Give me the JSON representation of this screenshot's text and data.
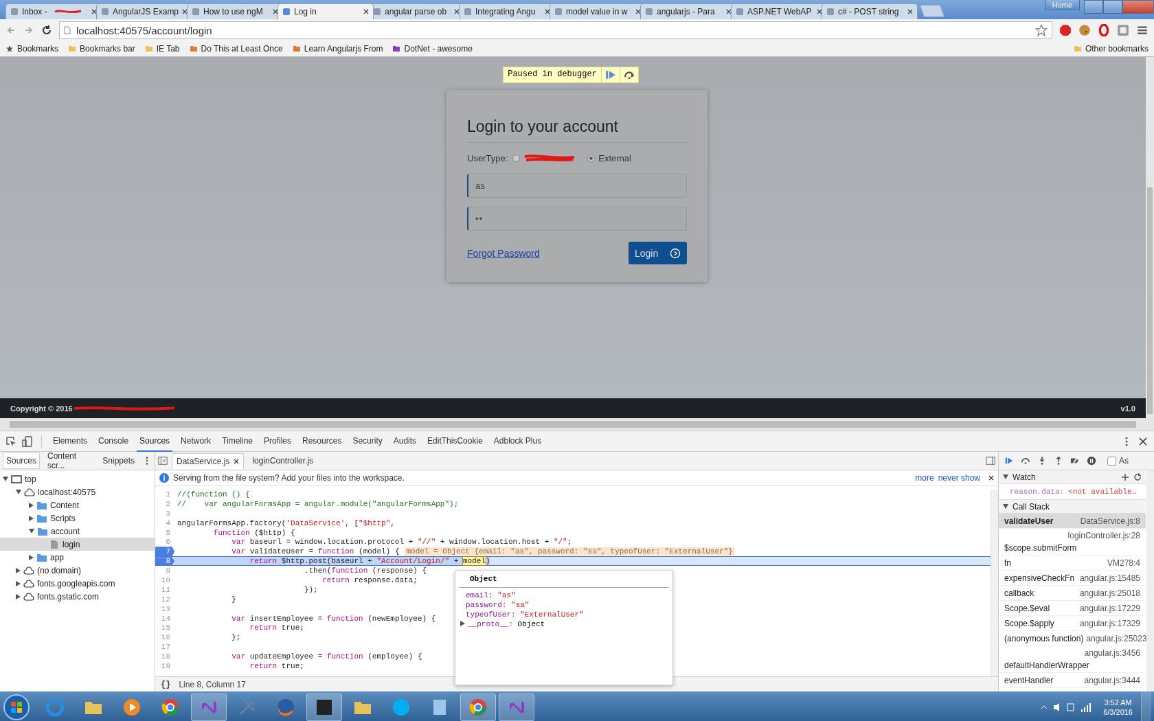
{
  "browser": {
    "tabs": [
      {
        "label": "Inbox -",
        "selected": false,
        "redacted": true
      },
      {
        "label": "AngularJS Examp",
        "selected": false
      },
      {
        "label": "How to use ngM",
        "selected": false
      },
      {
        "label": "Log in",
        "selected": true
      },
      {
        "label": "angular parse ob",
        "selected": false
      },
      {
        "label": "Integrating Angu",
        "selected": false
      },
      {
        "label": "model value in w",
        "selected": false
      },
      {
        "label": "angularjs - Para",
        "selected": false
      },
      {
        "label": "ASP.NET WebAP",
        "selected": false
      },
      {
        "label": "c# - POST string",
        "selected": false
      }
    ],
    "home_button": "Home",
    "address": "localhost:40575/account/login",
    "bookmarks": [
      "Bookmarks",
      "Bookmarks bar",
      "IE Tab",
      "Do This at Least Once",
      "Learn Angularjs From",
      "DotNet - awesome"
    ],
    "other_bookmarks": "Other bookmarks"
  },
  "page": {
    "debugger_banner": "Paused in debugger",
    "login": {
      "title": "Login to your account",
      "user_type_label": "UserType:",
      "options": [
        {
          "selected": false,
          "redacted": true
        },
        {
          "label": "External",
          "selected": true
        }
      ],
      "email": "as",
      "password": "••",
      "forgot_link": "Forgot Password",
      "login_button": "Login"
    },
    "footer": {
      "copyright": "Copyright © 2016",
      "version": "v1.0"
    }
  },
  "devtools": {
    "panels": [
      {
        "label": "Elements",
        "selected": false
      },
      {
        "label": "Console",
        "selected": false
      },
      {
        "label": "Sources",
        "selected": true
      },
      {
        "label": "Network",
        "selected": false
      },
      {
        "label": "Timeline",
        "selected": false
      },
      {
        "label": "Profiles",
        "selected": false
      },
      {
        "label": "Resources",
        "selected": false
      },
      {
        "label": "Security",
        "selected": false
      },
      {
        "label": "Audits",
        "selected": false
      },
      {
        "label": "EditThisCookie",
        "selected": false
      },
      {
        "label": "Adblock Plus",
        "selected": false
      }
    ],
    "navigator_tabs": [
      {
        "label": "Sources",
        "selected": true
      },
      {
        "label": "Content scr...",
        "selected": false
      },
      {
        "label": "Snippets",
        "selected": false
      }
    ],
    "tree": [
      {
        "label": "top",
        "kind": "frame",
        "expanded": true,
        "selected": false,
        "children": [
          {
            "label": "localhost:40575",
            "kind": "domain",
            "expanded": true,
            "selected": false,
            "children": [
              {
                "label": "Content",
                "kind": "folder",
                "expanded": false,
                "selected": false
              },
              {
                "label": "Scripts",
                "kind": "folder",
                "expanded": false,
                "selected": false
              },
              {
                "label": "account",
                "kind": "folder",
                "expanded": true,
                "selected": false,
                "children": [
                  {
                    "label": "login",
                    "kind": "file",
                    "selected": true
                  }
                ]
              },
              {
                "label": "app",
                "kind": "folder",
                "expanded": false,
                "selected": false
              }
            ]
          },
          {
            "label": "(no domain)",
            "kind": "domain",
            "expanded": false,
            "selected": false
          },
          {
            "label": "fonts.googleapis.com",
            "kind": "domain",
            "expanded": false,
            "selected": false
          },
          {
            "label": "fonts.gstatic.com",
            "kind": "domain",
            "expanded": false,
            "selected": false
          }
        ]
      }
    ],
    "editor_tabs": [
      {
        "label": "DataService.js",
        "selected": true,
        "closable": true
      },
      {
        "label": "loginController.js",
        "selected": false,
        "closable": false
      }
    ],
    "infobar": {
      "text": "Serving from the file system? Add your files into the workspace.",
      "links": [
        "more",
        "never show"
      ]
    },
    "code": [
      {
        "num": "1",
        "tokens": [
          {
            "kind": "comment",
            "text": "//(function () {"
          }
        ]
      },
      {
        "num": "2",
        "tokens": [
          {
            "kind": "comment",
            "text": "//    var angularFormsApp = angular.module(\"angularFormsApp\");"
          }
        ]
      },
      {
        "num": "3"
      },
      {
        "num": "4",
        "tokens": [
          {
            "kind": "plain",
            "text": "angularFormsApp.factory("
          },
          {
            "kind": "string",
            "text": "'DataService'"
          },
          {
            "kind": "plain",
            "text": ", ["
          },
          {
            "kind": "string",
            "text": "\"$http\""
          },
          {
            "kind": "plain",
            "text": ","
          }
        ]
      },
      {
        "num": "5",
        "tokens": [
          {
            "kind": "keyword",
            "text": "        function"
          },
          {
            "kind": "plain",
            "text": " ($http) {"
          }
        ]
      },
      {
        "num": "6",
        "tokens": [
          {
            "kind": "keyword",
            "text": "            var"
          },
          {
            "kind": "plain",
            "text": " baseurl = window.location.protocol + "
          },
          {
            "kind": "string",
            "text": "\"//\""
          },
          {
            "kind": "plain",
            "text": " + window.location.host + "
          },
          {
            "kind": "string",
            "text": "\"/\""
          },
          {
            "kind": "plain",
            "text": ";"
          }
        ]
      },
      {
        "num": "7",
        "breakpoint": true,
        "tokens": [
          {
            "kind": "keyword",
            "text": "            var"
          },
          {
            "kind": "plain",
            "text": " validateUser = "
          },
          {
            "kind": "keyword",
            "text": "function"
          },
          {
            "kind": "plain",
            "text": " (model) {"
          }
        ],
        "inline_value": "model = Object {email: \"as\", password: \"sa\", typeofUser: \"ExternalUser\"}"
      },
      {
        "num": "8",
        "breakpoint": true,
        "current": true,
        "tokens": [
          {
            "kind": "keyword",
            "text": "                return"
          },
          {
            "kind": "plain",
            "text": " $http.post(baseurl + "
          },
          {
            "kind": "string",
            "text": "\"Account/Login/\""
          },
          {
            "kind": "plain",
            "text": " + "
          },
          {
            "kind": "highlight",
            "text": "model"
          },
          {
            "kind": "plain",
            "text": ")"
          }
        ]
      },
      {
        "num": "9",
        "tokens": [
          {
            "kind": "plain",
            "text": "                            .then("
          },
          {
            "kind": "keyword",
            "text": "function"
          },
          {
            "kind": "plain",
            "text": " (response) {"
          }
        ]
      },
      {
        "num": "10",
        "tokens": [
          {
            "kind": "keyword",
            "text": "                                return"
          },
          {
            "kind": "plain",
            "text": " response.data;"
          }
        ]
      },
      {
        "num": "11",
        "tokens": [
          {
            "kind": "plain",
            "text": "                            });"
          }
        ]
      },
      {
        "num": "12",
        "tokens": [
          {
            "kind": "plain",
            "text": "            }"
          }
        ]
      },
      {
        "num": "13"
      },
      {
        "num": "14",
        "tokens": [
          {
            "kind": "keyword",
            "text": "            var"
          },
          {
            "kind": "plain",
            "text": " insertEmployee = "
          },
          {
            "kind": "keyword",
            "text": "function"
          },
          {
            "kind": "plain",
            "text": " (newEmployee) {"
          }
        ]
      },
      {
        "num": "15",
        "tokens": [
          {
            "kind": "keyword",
            "text": "                return"
          },
          {
            "kind": "plain",
            "text": " true;"
          }
        ]
      },
      {
        "num": "16",
        "tokens": [
          {
            "kind": "plain",
            "text": "            };"
          }
        ]
      },
      {
        "num": "17"
      },
      {
        "num": "18",
        "tokens": [
          {
            "kind": "keyword",
            "text": "            var"
          },
          {
            "kind": "plain",
            "text": " updateEmployee = "
          },
          {
            "kind": "keyword",
            "text": "function"
          },
          {
            "kind": "plain",
            "text": " (employee) {"
          }
        ]
      },
      {
        "num": "19",
        "tokens": [
          {
            "kind": "keyword",
            "text": "                return"
          },
          {
            "kind": "plain",
            "text": " true;"
          }
        ]
      }
    ],
    "popover": {
      "title": "Object",
      "props": [
        {
          "key": "email:",
          "value": "\"as\""
        },
        {
          "key": "password:",
          "value": "\"sa\""
        },
        {
          "key": "typeofUser:",
          "value": "\"ExternalUser\""
        }
      ],
      "proto_key": "__proto__:",
      "proto_value": "Object"
    },
    "status": {
      "format_button": "{}",
      "position": "Line 8, Column 17"
    },
    "async_checked": false,
    "async_label": "As",
    "watch": {
      "title": "Watch",
      "expression": "reason.data:",
      "value": "<not available…"
    },
    "call_stack": {
      "title": "Call Stack",
      "frames": [
        {
          "name": "validateUser",
          "location": "DataService.js:8",
          "selected": true
        },
        {
          "name": "$scope.submitForm",
          "location": "loginController.js:28",
          "selected": false,
          "wrap": true
        },
        {
          "name": "fn",
          "location": "VM278:4",
          "selected": false
        },
        {
          "name": "expensiveCheckFn",
          "location": "angular.js:15485",
          "selected": false
        },
        {
          "name": "callback",
          "location": "angular.js:25018",
          "selected": false
        },
        {
          "name": "Scope.$eval",
          "location": "angular.js:17229",
          "selected": false
        },
        {
          "name": "Scope.$apply",
          "location": "angular.js:17329",
          "selected": false
        },
        {
          "name": "(anonymous function)",
          "location": "angular.js:25023",
          "selected": false
        },
        {
          "name": "defaultHandlerWrapper",
          "location": "angular.js:3456",
          "selected": false,
          "wrap": true
        },
        {
          "name": "eventHandler",
          "location": "angular.js:3444",
          "selected": false
        }
      ]
    }
  },
  "taskbar": {
    "time": "3:52 AM",
    "date": "6/3/2016"
  }
}
